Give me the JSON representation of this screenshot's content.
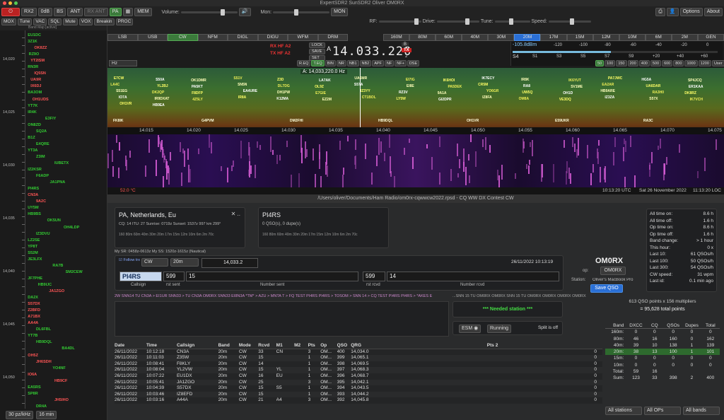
{
  "window": {
    "title": "ExpertSDR2 SunSDR2   Oliver OM0RX"
  },
  "toolbar1": {
    "rx": "RX2",
    "gain": "0dB",
    "bs": "BS",
    "ant": "ANT",
    "rxant": "RX ANT",
    "pa": "PA",
    "mem": "MEM",
    "volume": "Volume:",
    "mon": "Mon:",
    "mon_sel": "MON",
    "options": "Options",
    "about": "About"
  },
  "toolbar2": {
    "items": [
      "MOX",
      "Tune",
      "VAC",
      "SQL",
      "Mute",
      "VOX",
      "Breakin",
      "PROC"
    ],
    "rf": "RF:",
    "drive": "Drive:",
    "tune": "Tune:",
    "speed": "Speed:",
    "modes": [
      "LSB",
      "USB",
      "CW",
      "NFM",
      "DIGL",
      "DIGU",
      "WFM",
      "DRM"
    ],
    "bands": [
      "160M",
      "80M",
      "60M",
      "40M",
      "30M",
      "20M",
      "17M",
      "15M",
      "12M",
      "10M",
      "6M",
      "2M",
      "GEN"
    ]
  },
  "bandmap": {
    "title": "Band Map [active]",
    "scale": [
      "14,020",
      "14,025",
      "14,030",
      "14,035",
      "14,040",
      "14,045",
      "14,050"
    ],
    "step": "30 pz/kHz",
    "range": "16 min",
    "calls": [
      [
        "EU1DC",
        "#3c3",
        1
      ],
      [
        "3Z1K",
        "#3c3",
        1
      ],
      [
        "OK8ZZ",
        "#f55",
        8
      ],
      [
        "RZ9O",
        "#3c3",
        2
      ],
      [
        "YT2ISM",
        "#f55",
        4
      ],
      [
        "RN3R",
        "#3c3",
        1
      ],
      [
        "IQ5SN",
        "#f55",
        8
      ],
      [
        "UA9R",
        "#f55",
        4
      ],
      [
        "IX6DJ",
        "#f55",
        4
      ],
      [
        "BA3OM",
        "#3c3",
        1
      ],
      [
        "OH1UDS",
        "#f55",
        6
      ],
      [
        "YT7K",
        "#3c3",
        1
      ],
      [
        "IR4K",
        "#3c3",
        1
      ],
      [
        "E3FIY",
        "#3c3",
        20
      ],
      [
        "ON8ZD",
        "#3c3",
        1
      ],
      [
        "SQ2A",
        "#3c3",
        10
      ],
      [
        "B1Z",
        "#3c3",
        1
      ],
      [
        "E4QRE",
        "#3c3",
        10
      ],
      [
        "YT3A",
        "#3c3",
        1
      ],
      [
        "Z3IM",
        "#3c3",
        10
      ],
      [
        "IUBETX",
        "#3c3",
        30
      ],
      [
        "IZ2KSR",
        "#3c3",
        1
      ],
      [
        "F6ADP",
        "#3c3",
        10
      ],
      [
        "JA1PNA",
        "#3c3",
        25
      ],
      [
        "PI4RS",
        "#3c3",
        1
      ],
      [
        "CN3A",
        "#f55",
        1
      ],
      [
        "9A2C",
        "#f55",
        10
      ],
      [
        "UY5M",
        "#3c3",
        1
      ],
      [
        "HB9BS",
        "#3c3",
        1
      ],
      [
        "OK5UN",
        "#3c3",
        22
      ],
      [
        "OH4LDP",
        "#3c3",
        40
      ],
      [
        "IZ3DVU",
        "#3c3",
        10
      ],
      [
        "LZ2SE",
        "#3c3",
        1
      ],
      [
        "YP8T",
        "#3c3",
        1
      ],
      [
        "S52M",
        "#3c3",
        1
      ],
      [
        "JE3LFX",
        "#3c3",
        1
      ],
      [
        "RA7B",
        "#3c3",
        28
      ],
      [
        "SM2CEW",
        "#3c3",
        42
      ],
      [
        "JF7PHE",
        "#3c3",
        1
      ],
      [
        "HB9IJC",
        "#3c3",
        12
      ],
      [
        "JA1ZGO",
        "#f55",
        24
      ],
      [
        "DA2X",
        "#3c3",
        1
      ],
      [
        "S57DX",
        "#f55",
        1
      ],
      [
        "Z2BFD",
        "#f55",
        1
      ],
      [
        "A71BX",
        "#f55",
        1
      ],
      [
        "AA4A",
        "#f55",
        1
      ],
      [
        "DL6FBL",
        "#3c3",
        10
      ],
      [
        "YT7B",
        "#3c3",
        1
      ],
      [
        "HB9DQL",
        "#3c3",
        10
      ],
      [
        "BA4DL",
        "#3c3",
        38
      ],
      [
        "OH5Z",
        "#f55",
        1
      ],
      [
        "JH6SDH",
        "#f55",
        10
      ],
      [
        "YO4NF",
        "#3c3",
        28
      ],
      [
        "IO6A",
        "#f55",
        1
      ],
      [
        "HB9CF",
        "#f55",
        30
      ],
      [
        "EA5RS",
        "#3c3",
        1
      ],
      [
        "SP8R",
        "#3c3",
        1
      ],
      [
        "JH5IHO",
        "#f55",
        30
      ],
      [
        "DR4A",
        "#3c3",
        10
      ]
    ]
  },
  "radio": {
    "rx": "RX HF A2",
    "tx": "TX HF A2",
    "lock": "LOCK",
    "save": "SAVE",
    "set": "SET",
    "freq": "14.033.220",
    "filt": "A",
    "tx_num": "2",
    "tx_label": "TX",
    "dbm": "-105.8dBm",
    "smeter_scale": [
      "-120",
      "-100",
      "-80",
      "-60",
      "-40",
      "-20",
      "0"
    ],
    "s_scale": [
      "S1",
      "S3",
      "S5",
      "S7",
      "S9",
      "+20",
      "+40",
      "+60"
    ],
    "s_label": "S4",
    "bw": [
      "50",
      "100",
      "150",
      "200",
      "400",
      "500",
      "600",
      "800",
      "1000",
      "1200",
      "User"
    ],
    "hz": "Hz",
    "dsp": [
      "R.EQ",
      "T.EQ",
      "BIN",
      "NR",
      "NB1",
      "NB2",
      "APF",
      "NF",
      "NF+",
      "DSE"
    ],
    "center": "A: 14,033,220.0 Hz"
  },
  "panadapter": {
    "ticks": [
      "14.015",
      "14.020",
      "14.025",
      "14.030",
      "14.035",
      "14.040",
      "14.045",
      "14.050",
      "14.055",
      "14.060",
      "14.065",
      "14.070",
      "14.075"
    ],
    "spots": [
      "E7CW",
      "S50A",
      "OK1DMR",
      "S51V",
      "Z3D",
      "LA7AK",
      "UA6MR",
      "EI7IG",
      "IK6HOI",
      "IK7ECY",
      "IR8K",
      "IK6YUT",
      "PA7JWC",
      "HG5A",
      "SP4JCQ",
      "LA4C",
      "YL2BJ",
      "PA5KT",
      "SN5N",
      "DL7DG",
      "OL9Z",
      "S57A",
      "EI8E",
      "PA5DEK",
      "CR5M",
      "RA8",
      "SV1ME",
      "EA2AR",
      "UA6DAR",
      "ER1KAA",
      "S51EG",
      "DK2QP",
      "F8DFP",
      "EA4URE",
      "DH1PW",
      "E7GIE",
      "IZ3YY",
      "RZ3V",
      "9A1A",
      "YO6GR",
      "UW5Q",
      "OH1D",
      "HB9ARE",
      "RA3H0",
      "DK8RZ",
      "IO7A",
      "IR9DXAT",
      "4Z5LY",
      "IR8A",
      "K12MA",
      "EZ2M",
      "CT1BOL",
      "LY5W",
      "GI2DPR",
      "IZ8FA",
      "OM8A",
      "VE3DQ",
      "IZ3ZA",
      "S57X",
      "IK7VCH",
      "OH1VR",
      "HB9EA"
    ],
    "bottom_calls": [
      "FK8IK",
      "G4PVM",
      "DM2FHI",
      "HB9DQL",
      "OH1VR",
      "E59UKR",
      "RA3C"
    ]
  },
  "statusbar": {
    "temp": "52.0 °C",
    "utc": "10:13:20 UTC",
    "date": "Sat 26 November 2022",
    "loc": "11:13:20 LOC"
  },
  "log": {
    "title": "/Users/oliver/Documents/Ham Radio/om0rx-cqwwcw2022.rpsd - CQ WW DX Contest CW",
    "country": "PA, Netherlands, Eu",
    "cqinfo": "CQ: 14  ITU: 27  Sunrise: 0719z  Sunset: 1537z  997 km  299°",
    "bandlist": "160 80m 60m 40m 30m 20m 17m 15m 12m 10m 6m 2m 70c",
    "mysr": "My SR: 0458z-0613z  My SS: 1520z-1615z (Nautical)",
    "callbox": "PI4RS",
    "callqso": "0 QSO(s), 0 dupe(s)",
    "follow": "Follow trx",
    "mode": "CW",
    "band": "20m",
    "freq": "14,033.2",
    "datetime": "26/11/2022   10:13:19",
    "call": "PI4RS",
    "rst_sent": "599",
    "num_sent": "15",
    "rst_rcvd": "599",
    "num_rcvd": "14",
    "lbl_call": "Callsign",
    "lbl_rst_sent": "rst sent",
    "lbl_num_sent": "Number sent",
    "lbl_rst_rcvd": "rst rcvd",
    "lbl_num_rcvd": "Number rcvd",
    "op_call": "OM0RX",
    "op_label": "op:",
    "op_value": "OM0RX",
    "station_label": "Station:",
    "station_value": "Oliver's MacBook Pro",
    "save_qso": "Save QSO",
    "cwlog": "2W SNN14 TU CN3A > EI1UR SNN33 > TU CN3A OM0RX SNN33 EI8N3A *TM* > AZU > MNTA T > FQ TEST PI4RS PI4RS > TOSOM > SNN 14 > CQ TEST PI4RS PI4RS > *AKES E",
    "cwlog2": "...SNN 15 TU  OM0RX  OM0RX SNN 15 TU  OM0RX  OM0RX  OM0RX  OM0RX",
    "needed": "*** Needed station ***",
    "esm": "ESM",
    "running": "Running",
    "split": "Split is off",
    "stats": [
      [
        "All time on:",
        "8.6 h"
      ],
      [
        "All time off:",
        "1.6 h"
      ],
      [
        "Op time on:",
        "8.6 h"
      ],
      [
        "Op time off:",
        "1.6 h"
      ],
      [
        "Band change:",
        "> 1 hour"
      ],
      [
        "This hour:",
        "0 x"
      ],
      [
        "Last 10:",
        "61 QSOs/h"
      ],
      [
        "Last 100:",
        "50 QSOs/h"
      ],
      [
        "Last 300:",
        "54 QSOs/h"
      ],
      [
        "CW speed:",
        "31 wpm"
      ],
      [
        "Last id:",
        "0.1 min ago"
      ]
    ],
    "score1": "613 QSO points x 156 multipliers",
    "score2": "= 95,628 total points",
    "bands": {
      "header": [
        "Band",
        "DXCC",
        "CQ",
        "QSOs",
        "Dupes",
        "Total"
      ],
      "rows": [
        [
          "160m:",
          "0",
          "0",
          "0",
          "0",
          "0"
        ],
        [
          "80m:",
          "46",
          "16",
          "160",
          "0",
          "162"
        ],
        [
          "40m:",
          "39",
          "10",
          "138",
          "1",
          "139"
        ],
        [
          "20m:",
          "38",
          "13",
          "100",
          "1",
          "101"
        ],
        [
          "15m:",
          "0",
          "0",
          "0",
          "0",
          "0"
        ],
        [
          "10m:",
          "0",
          "0",
          "0",
          "0",
          "0"
        ],
        [
          "Total:",
          "59",
          "16",
          "",
          "",
          ""
        ],
        [
          "Sum:",
          "123",
          "33",
          "398",
          "2",
          "400"
        ]
      ]
    },
    "filters": [
      "All stations",
      "All OPs",
      "All bands"
    ],
    "columns": [
      "Date",
      "Time",
      "Callsign",
      "Band",
      "Mode",
      "Rcvd",
      "M1",
      "M2",
      "Pts",
      "Op",
      "QSO",
      "QRG",
      "Pts 2"
    ],
    "qsos": [
      [
        "26/11/2022",
        "10:12:18",
        "CN3A",
        "20m",
        "CW",
        "33",
        "CN",
        "",
        "3",
        "OM...",
        "400",
        "14,034.0",
        "0"
      ],
      [
        "26/11/2022",
        "10:11:03",
        "Z35W",
        "20m",
        "CW",
        "15",
        "",
        "",
        "1",
        "OM...",
        "399",
        "14,065.1",
        "0"
      ],
      [
        "26/11/2022",
        "10:08:41",
        "F8KLY",
        "20m",
        "CW",
        "14",
        "",
        "",
        "1",
        "OM...",
        "398",
        "14,069.5",
        "0"
      ],
      [
        "26/11/2022",
        "10:08:04",
        "YL2VW",
        "20m",
        "CW",
        "15",
        "YL",
        "",
        "1",
        "OM...",
        "397",
        "14,068.3",
        "0"
      ],
      [
        "26/11/2022",
        "10:07:22",
        "EU1DX",
        "20m",
        "CW",
        "16",
        "EU",
        "",
        "1",
        "OM...",
        "396",
        "14,068.7",
        "0"
      ],
      [
        "26/11/2022",
        "10:05:41",
        "JA1ZGO",
        "20m",
        "CW",
        "25",
        "",
        "",
        "3",
        "OM...",
        "395",
        "14,042.1",
        "0"
      ],
      [
        "26/11/2022",
        "10:04:39",
        "S57DX",
        "20m",
        "CW",
        "15",
        "S5",
        "",
        "1",
        "OM...",
        "394",
        "14,043.5",
        "0"
      ],
      [
        "26/11/2022",
        "10:03:46",
        "IZ8EFD",
        "20m",
        "CW",
        "15",
        "",
        "",
        "1",
        "OM...",
        "393",
        "14,044.2",
        "0"
      ],
      [
        "26/11/2022",
        "10:03:16",
        "A44A",
        "20m",
        "CW",
        "21",
        "A4",
        "",
        "3",
        "OM...",
        "392",
        "14,045.8",
        "0"
      ]
    ]
  }
}
